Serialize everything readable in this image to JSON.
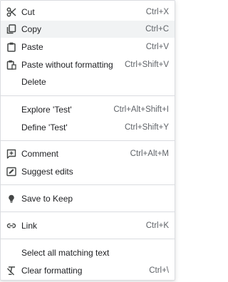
{
  "menu": {
    "items": [
      {
        "label": "Cut",
        "shortcut": "Ctrl+X",
        "icon": "scissors-icon"
      },
      {
        "label": "Copy",
        "shortcut": "Ctrl+C",
        "icon": "copy-icon"
      },
      {
        "label": "Paste",
        "shortcut": "Ctrl+V",
        "icon": "clipboard-icon"
      },
      {
        "label": "Paste without formatting",
        "shortcut": "Ctrl+Shift+V",
        "icon": "paste-plain-icon"
      },
      {
        "label": "Delete",
        "shortcut": ""
      },
      {
        "label": "Explore 'Test'",
        "shortcut": "Ctrl+Alt+Shift+I"
      },
      {
        "label": "Define 'Test'",
        "shortcut": "Ctrl+Shift+Y"
      },
      {
        "label": "Comment",
        "shortcut": "Ctrl+Alt+M",
        "icon": "add-comment-icon"
      },
      {
        "label": "Suggest edits",
        "shortcut": "",
        "icon": "suggest-edits-icon"
      },
      {
        "label": "Save to Keep",
        "shortcut": "",
        "icon": "keep-bulb-icon"
      },
      {
        "label": "Link",
        "shortcut": "Ctrl+K",
        "icon": "link-icon"
      },
      {
        "label": "Select all matching text",
        "shortcut": ""
      },
      {
        "label": "Clear formatting",
        "shortcut": "Ctrl+\\",
        "icon": "clear-formatting-icon"
      }
    ],
    "highlighted_item": "Copy"
  },
  "colors": {
    "text": "#202124",
    "shortcut": "#5f6368",
    "highlight": "#f1f3f4",
    "separator": "#dadce0",
    "icon": "#444746"
  }
}
